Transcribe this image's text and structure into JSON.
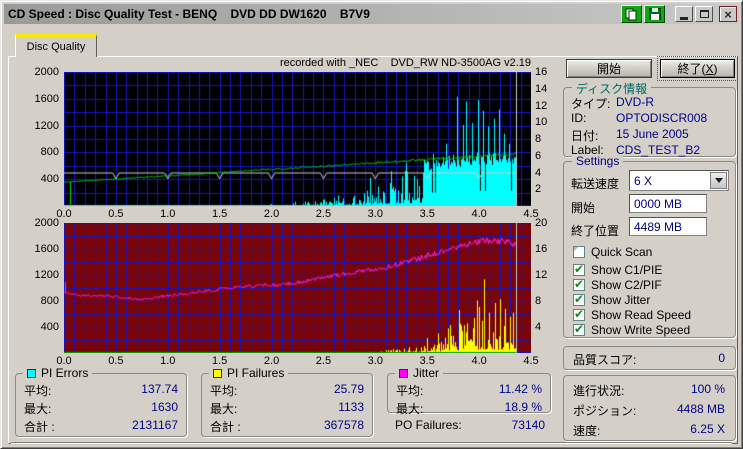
{
  "window": {
    "title": "CD Speed : Disc Quality Test - BENQ    DVD DD DW1620    B7V9",
    "titlebar_icons": [
      "copy-icon",
      "save-icon",
      "minimize",
      "maximize",
      "close"
    ]
  },
  "tab": {
    "label": "Disc Quality"
  },
  "chart_header": "recorded with _NEC    DVD_RW ND-3500AG v2.19",
  "chart_data": [
    {
      "id": "pie-chart",
      "type": "area",
      "bg": "#000000",
      "grid_color": "#1414c8",
      "seed": 7,
      "x_range": [
        0,
        4.5
      ],
      "x_ticks": [
        "0.0",
        "0.5",
        "1.0",
        "1.5",
        "2.0",
        "2.5",
        "3.0",
        "3.5",
        "4.0",
        "4.5"
      ],
      "left_axis": {
        "range": [
          0,
          2000
        ],
        "ticks": [
          400,
          800,
          1200,
          1600,
          2000
        ],
        "grid_step": 200
      },
      "right_axis": {
        "range": [
          0,
          16
        ],
        "ticks": [
          2,
          4,
          6,
          8,
          10,
          12,
          14,
          16
        ]
      },
      "data_end_x": 4.36,
      "end_line_color": "#c8c8c8",
      "series": [
        {
          "name": "PI Errors (C1/PIE)",
          "color": "#00ffff",
          "style": "spikes",
          "axis": "left",
          "solid_from": 3.45,
          "envelope": [
            [
              0,
              5
            ],
            [
              1.0,
              6
            ],
            [
              1.8,
              9
            ],
            [
              2.1,
              28
            ],
            [
              2.3,
              65
            ],
            [
              2.5,
              115
            ],
            [
              2.7,
              185
            ],
            [
              2.9,
              265
            ],
            [
              3.1,
              375
            ],
            [
              3.3,
              490
            ],
            [
              3.45,
              630
            ],
            [
              3.6,
              690
            ],
            [
              3.8,
              735
            ],
            [
              4.0,
              765
            ],
            [
              4.2,
              740
            ],
            [
              4.36,
              770
            ]
          ],
          "spikes": [
            [
              2.95,
              420
            ],
            [
              3.15,
              520
            ],
            [
              3.3,
              640
            ],
            [
              3.56,
              780
            ],
            [
              3.68,
              930
            ],
            [
              3.79,
              1630
            ],
            [
              3.84,
              1210
            ],
            [
              3.87,
              1560
            ],
            [
              3.93,
              1240
            ],
            [
              3.99,
              1580
            ],
            [
              4.04,
              1420
            ],
            [
              4.09,
              1190
            ],
            [
              4.14,
              1300
            ],
            [
              4.19,
              1440
            ],
            [
              4.24,
              1080
            ],
            [
              4.29,
              930
            ]
          ],
          "avg": 137.74,
          "max": 1630,
          "total": 2131167
        },
        {
          "name": "Write Speed",
          "color": "#c8c8c8",
          "style": "dipline",
          "axis": "right",
          "base": 4.0,
          "dip_value": 3.25,
          "dips_at": [
            0.5,
            1.0,
            1.5,
            2.0,
            2.5,
            3.0,
            3.5,
            4.0
          ]
        },
        {
          "name": "Read Speed",
          "color": "#00dd00",
          "style": "noisyline",
          "axis": "right",
          "noise": [
            0.04,
            0.14
          ],
          "start_glitch_x": 0.055,
          "points": [
            [
              0,
              2.85
            ],
            [
              0.5,
              3.22
            ],
            [
              1.0,
              3.6
            ],
            [
              1.5,
              4.0
            ],
            [
              2.0,
              4.38
            ],
            [
              2.5,
              4.77
            ],
            [
              3.0,
              5.15
            ],
            [
              3.5,
              5.55
            ],
            [
              4.0,
              5.95
            ],
            [
              4.36,
              6.22
            ]
          ]
        }
      ]
    },
    {
      "id": "pif-chart",
      "type": "area",
      "bg": "#7a0404",
      "grid_color": "#1414c8",
      "seed": 13,
      "x_range": [
        0,
        4.5
      ],
      "x_ticks": [
        "0.0",
        "0.5",
        "1.0",
        "1.5",
        "2.0",
        "2.5",
        "3.0",
        "3.5",
        "4.0",
        "4.5"
      ],
      "left_axis": {
        "range": [
          0,
          2000
        ],
        "ticks": [
          400,
          800,
          1200,
          1600,
          2000
        ],
        "grid_step": 200
      },
      "right_axis": {
        "range": [
          0,
          20
        ],
        "ticks": [
          4,
          8,
          12,
          16,
          20
        ]
      },
      "data_end_x": 4.36,
      "end_line_color": "#c8c8c8",
      "series": [
        {
          "name": "PI Failures (C2/PIF)",
          "color": "#ffff00",
          "style": "spikes",
          "axis": "left",
          "envelope": [
            [
              0,
              4
            ],
            [
              2.5,
              6
            ],
            [
              3.0,
              28
            ],
            [
              3.2,
              65
            ],
            [
              3.4,
              140
            ],
            [
              3.6,
              290
            ],
            [
              3.8,
              490
            ],
            [
              3.95,
              570
            ],
            [
              4.05,
              650
            ],
            [
              4.15,
              610
            ],
            [
              4.25,
              570
            ],
            [
              4.36,
              630
            ]
          ],
          "spikes": [
            [
              3.5,
              230
            ],
            [
              3.6,
              300
            ],
            [
              3.7,
              380
            ],
            [
              3.81,
              660
            ],
            [
              3.95,
              540
            ],
            [
              4.0,
              710
            ],
            [
              4.05,
              1133
            ],
            [
              4.1,
              620
            ],
            [
              4.15,
              770
            ],
            [
              4.2,
              830
            ],
            [
              4.25,
              680
            ],
            [
              4.3,
              560
            ],
            [
              4.33,
              620
            ],
            [
              4.36,
              840
            ]
          ],
          "avg": 25.79,
          "max": 1133,
          "total": 367578
        },
        {
          "name": "baseline",
          "color": "#00a800",
          "style": "baseline"
        },
        {
          "name": "Jitter",
          "color": "#ff22ff",
          "style": "noisyline",
          "axis": "right",
          "noise": [
            0.14,
            0.34
          ],
          "start_spike": [
            0.012,
            10.9
          ],
          "points": [
            [
              0,
              9.3
            ],
            [
              0.15,
              8.8
            ],
            [
              0.4,
              8.8
            ],
            [
              0.6,
              8.5
            ],
            [
              0.75,
              8.2
            ],
            [
              0.9,
              8.6
            ],
            [
              1.1,
              9.0
            ],
            [
              1.3,
              9.4
            ],
            [
              1.5,
              9.8
            ],
            [
              1.7,
              10.2
            ],
            [
              1.9,
              10.4
            ],
            [
              2.1,
              10.5
            ],
            [
              2.3,
              11.0
            ],
            [
              2.5,
              11.7
            ],
            [
              2.7,
              12.2
            ],
            [
              2.9,
              12.6
            ],
            [
              3.1,
              13.2
            ],
            [
              3.3,
              14.0
            ],
            [
              3.5,
              15.0
            ],
            [
              3.7,
              15.9
            ],
            [
              3.9,
              16.8
            ],
            [
              4.05,
              17.3
            ],
            [
              4.2,
              17.2
            ],
            [
              4.3,
              17.0
            ],
            [
              4.36,
              16.4
            ]
          ],
          "avg_pct": 11.42,
          "max_pct": 18.9
        }
      ]
    }
  ],
  "sidebar": {
    "start_button": "開始",
    "exit_button": {
      "prefix": "終了(",
      "mnemonic": "X",
      "suffix": ")"
    },
    "disc_info": {
      "title": "ディスク情報",
      "rows": [
        {
          "label": "タイプ:",
          "value": "DVD-R"
        },
        {
          "label": "ID:",
          "value": "OPTODISCR008"
        },
        {
          "label": "日付:",
          "value": "15 June 2005"
        },
        {
          "label": "Label:",
          "value": "CDS_TEST_B2"
        }
      ]
    },
    "settings": {
      "title": "Settings",
      "speed_label": "転送速度",
      "speed_value": "6 X",
      "start_label": "開始",
      "start_value": "0000 MB",
      "end_label": "終了位置",
      "end_value": "4489 MB",
      "checkboxes": [
        {
          "label": "Quick Scan",
          "checked": false
        },
        {
          "label": "Show C1/PIE",
          "checked": true
        },
        {
          "label": "Show C2/PIF",
          "checked": true
        },
        {
          "label": "Show Jitter",
          "checked": true
        },
        {
          "label": "Show Read Speed",
          "checked": true
        },
        {
          "label": "Show Write Speed",
          "checked": true
        }
      ]
    },
    "quality": {
      "label": "品質スコア:",
      "value": "0"
    },
    "progress": {
      "rows": [
        {
          "label": "進行状況:",
          "value": "100 %"
        },
        {
          "label": "ポジション:",
          "value": "4488 MB"
        },
        {
          "label": "速度:",
          "value": "6.25 X"
        }
      ]
    }
  },
  "stats": {
    "boxes": [
      {
        "name": "PI Errors",
        "square_color": "#00ffff",
        "rows": [
          {
            "label": "平均:",
            "value": "137.74"
          },
          {
            "label": "最大:",
            "value": "1630"
          },
          {
            "label": "合計 :",
            "value": "2131167"
          }
        ]
      },
      {
        "name": "PI Failures",
        "square_color": "#ffff00",
        "rows": [
          {
            "label": "平均:",
            "value": "25.79"
          },
          {
            "label": "最大:",
            "value": "1133"
          },
          {
            "label": "合計 :",
            "value": "367578"
          }
        ]
      },
      {
        "name": "Jitter",
        "square_color": "#ff00ff",
        "rows": [
          {
            "label": "平均:",
            "value": "11.42 %"
          },
          {
            "label": "最大:",
            "value": "18.9 %"
          }
        ]
      }
    ],
    "po_failures": {
      "label": "PO Failures:",
      "value": "73140"
    }
  }
}
